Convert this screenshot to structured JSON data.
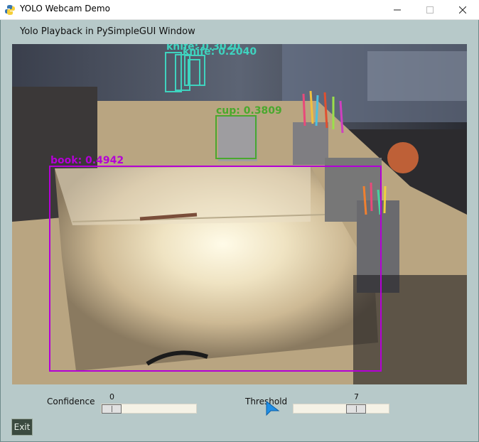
{
  "window": {
    "title": "YOLO Webcam Demo",
    "min_glyph": "—",
    "max_glyph": "☐",
    "close_glyph": "✕"
  },
  "header": {
    "label": "Yolo Playback in PySimpleGUI Window"
  },
  "detections": [
    {
      "label": "book: 0.4942",
      "color": "#b400d6"
    },
    {
      "label": "cup: 0.3809",
      "color": "#4aa82e"
    },
    {
      "label": "knife: 0.2040",
      "color": "#3fd3bf"
    },
    {
      "label": "knife: 0.3020",
      "color": "#3fd3bf"
    }
  ],
  "controls": {
    "confidence": {
      "label": "Confidence",
      "value": "0",
      "level": 0.0
    },
    "threshold": {
      "label": "Threshold",
      "value": "7",
      "level": 0.7
    },
    "exit_label": "Exit"
  },
  "icons": [
    "python-icon",
    "minimize-icon",
    "maximize-icon",
    "close-icon",
    "pointer-cursor-icon"
  ],
  "colors": {
    "window_bg": "#b7c9c9",
    "slider_track": "#f5f2e6",
    "exit_bg": "#3b4a3f"
  }
}
